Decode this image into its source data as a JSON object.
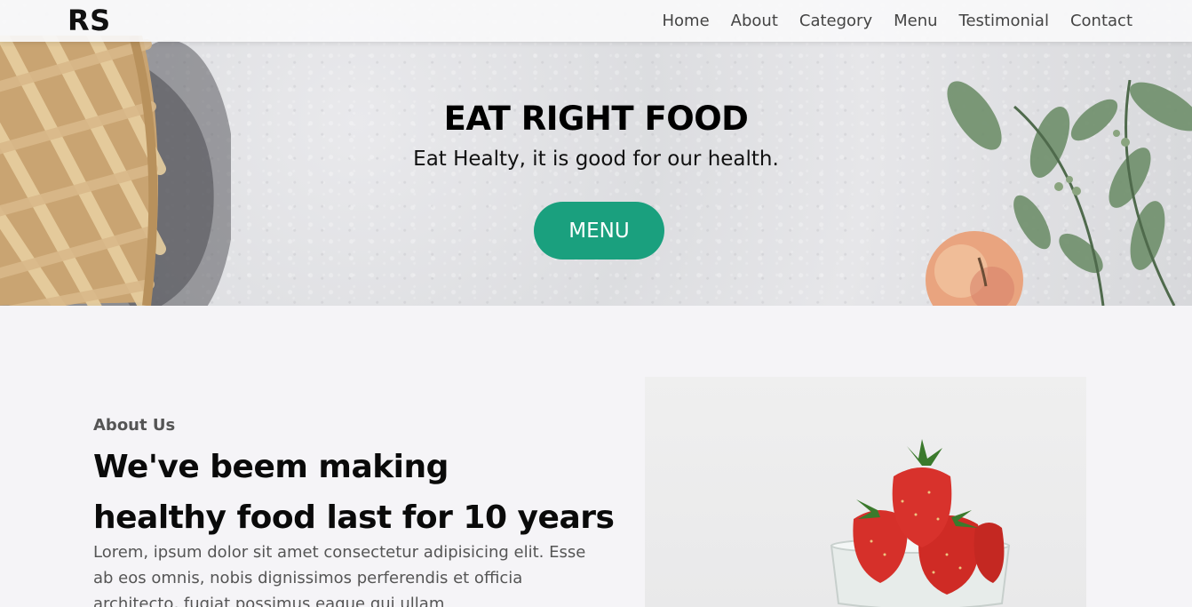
{
  "brand": {
    "logo": "RS"
  },
  "nav": {
    "items": [
      {
        "label": "Home"
      },
      {
        "label": "About"
      },
      {
        "label": "Category"
      },
      {
        "label": "Menu"
      },
      {
        "label": "Testimonial"
      },
      {
        "label": "Contact"
      }
    ]
  },
  "hero": {
    "title": "EAT RIGHT FOOD",
    "subtitle": "Eat Healty, it is good for our health.",
    "cta_label": "MENU"
  },
  "about": {
    "kicker": "About Us",
    "title_line1": "We've beem making",
    "title_line2": "healthy food last for 10 years",
    "body": "Lorem, ipsum dolor sit amet consectetur adipisicing elit. Esse ab eos omnis, nobis dignissimos perferendis et officia architecto, fugiat possimus eaque qui ullam"
  },
  "colors": {
    "accent": "#1aa07e",
    "background": "#f5f4f7",
    "text": "#111111"
  },
  "icons": [
    "pie-image",
    "apple-leaves-image",
    "strawberry-bowl-image"
  ]
}
